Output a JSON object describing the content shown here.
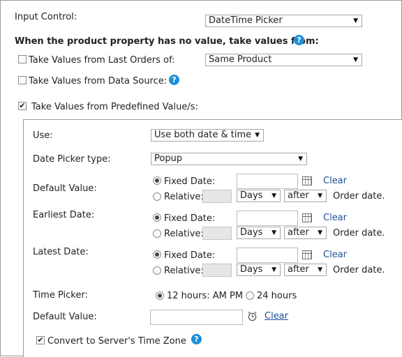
{
  "input_control": {
    "label": "Input Control:",
    "value": "DateTime Picker"
  },
  "no_value_heading": "When the product property has no value, take values from:",
  "last_orders": {
    "label": "Take Values from Last Orders of:",
    "checked": false,
    "value": "Same Product"
  },
  "data_source": {
    "label": "Take Values from Data Source:",
    "checked": false
  },
  "predefined": {
    "label": "Take Values from Predefined Value/s:",
    "checked": true
  },
  "use": {
    "label": "Use:",
    "value": "Use both date & time"
  },
  "date_picker_type": {
    "label": "Date Picker type:",
    "value": "Popup"
  },
  "date_rows": [
    {
      "label": "Default Value:",
      "fixed_label": "Fixed Date:",
      "relative_label": "Relative:",
      "unit": "Days",
      "direction": "after",
      "suffix": "Order date.",
      "clear": "Clear",
      "selected": "fixed"
    },
    {
      "label": "Earliest Date:",
      "fixed_label": "Fixed Date:",
      "relative_label": "Relative:",
      "unit": "Days",
      "direction": "after",
      "suffix": "Order date.",
      "clear": "Clear",
      "selected": "fixed"
    },
    {
      "label": "Latest Date:",
      "fixed_label": "Fixed Date:",
      "relative_label": "Relative:",
      "unit": "Days",
      "direction": "after",
      "suffix": "Order date.",
      "clear": "Clear",
      "selected": "fixed"
    }
  ],
  "time_picker": {
    "label": "Time Picker:",
    "option_12": "12 hours: AM PM",
    "option_24": "24 hours",
    "selected": "12"
  },
  "time_default": {
    "label": "Default Value:",
    "clear": "Clear"
  },
  "server_tz": {
    "label": "Convert to Server's Time Zone",
    "checked": true
  },
  "icons": {
    "help": "help-icon",
    "calendar": "calendar-icon",
    "clock": "clock-icon",
    "dropdown": "chevron-down-icon"
  },
  "help_glyph": "?",
  "check_glyph": "✔",
  "arrow_glyph": "▼",
  "colors": {
    "help_blue": "#1f8fd8",
    "link": "#1e4f9a"
  }
}
